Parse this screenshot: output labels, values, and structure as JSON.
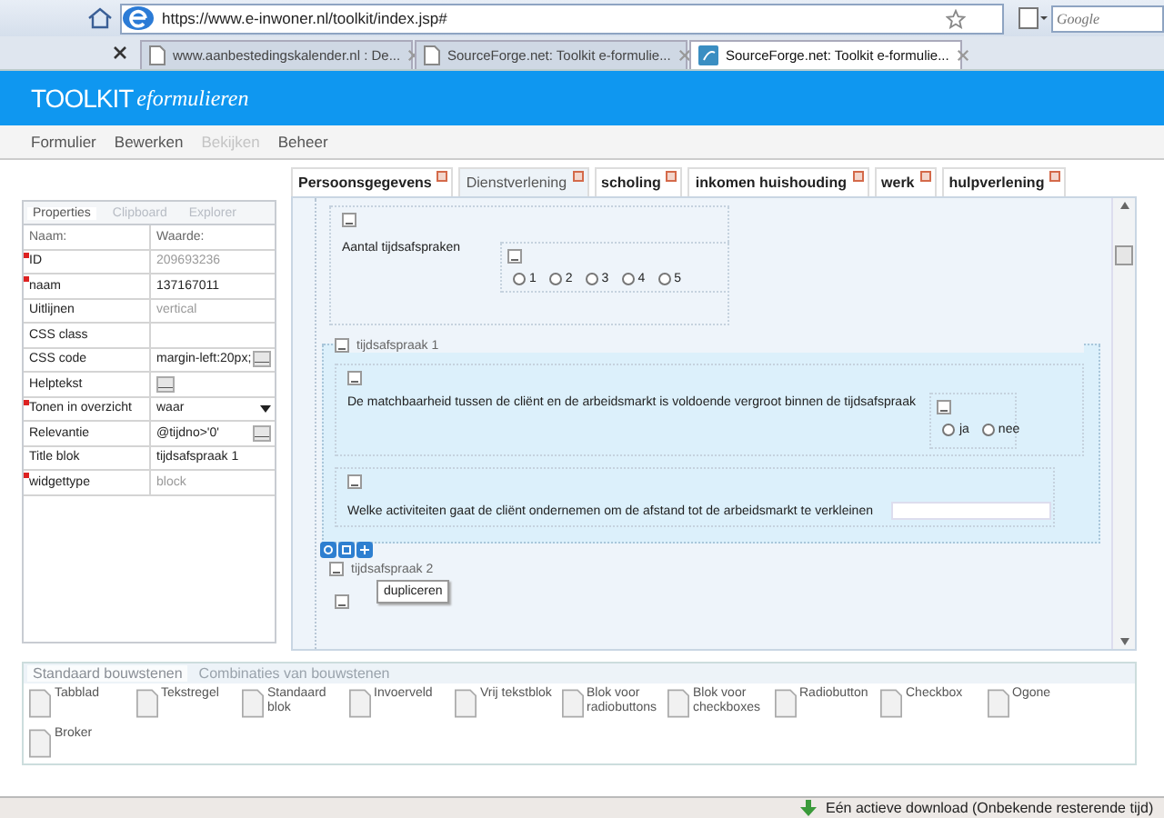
{
  "browser": {
    "address": "https://www.e-inwoner.nl/toolkit/index.jsp#",
    "search_placeholder": "Google",
    "tabs": [
      {
        "title": "www.aanbestedingskalender.nl : De...",
        "kind": "page",
        "selected": false
      },
      {
        "title": "SourceForge.net: Toolkit e-formulie...",
        "kind": "page",
        "selected": false
      },
      {
        "title": "SourceForge.net: Toolkit e-formulie...",
        "kind": "site",
        "selected": true
      }
    ]
  },
  "header": {
    "brand": "TOOLKIT",
    "subtitle": "eformulieren"
  },
  "menu": [
    {
      "label": "Formulier",
      "disabled": false
    },
    {
      "label": "Bewerken",
      "disabled": false
    },
    {
      "label": "Bekijken",
      "disabled": true
    },
    {
      "label": "Beheer",
      "disabled": false
    }
  ],
  "properties": {
    "tabs": [
      {
        "label": "Properties",
        "selected": true
      },
      {
        "label": "Clipboard",
        "selected": false
      },
      {
        "label": "Explorer",
        "selected": false
      }
    ],
    "columns": [
      "Naam:",
      "Waarde:"
    ],
    "rows": [
      {
        "name": "ID",
        "value": "209693236",
        "kind": "readonly",
        "required": true
      },
      {
        "name": "naam",
        "value": "137167011",
        "kind": "text",
        "required": true
      },
      {
        "name": "Uitlijnen",
        "value": "vertical",
        "kind": "readonly",
        "required": false
      },
      {
        "name": "CSS class",
        "kind": "text",
        "required": false
      },
      {
        "name": "CSS code",
        "value": "margin-left:20px;",
        "kind": "button",
        "required": false
      },
      {
        "name": "Helptekst",
        "kind": "button",
        "required": false
      },
      {
        "name": "Tonen in overzicht",
        "value": "waar",
        "kind": "select",
        "required": true
      },
      {
        "name": "Relevantie",
        "value": "@tijdno>'0'",
        "kind": "button",
        "required": false
      },
      {
        "name": "Title blok",
        "value": "tijdsafspraak 1",
        "kind": "text",
        "required": false
      },
      {
        "name": "widgettype",
        "value": "block",
        "kind": "readonly",
        "required": true
      }
    ]
  },
  "form_tabs": [
    {
      "label": "Persoonsgegevens",
      "selected": false
    },
    {
      "label": "Dienstverlening",
      "selected": true
    },
    {
      "label": "scholing",
      "selected": false
    },
    {
      "label": "inkomen huishouding",
      "selected": false
    },
    {
      "label": "werk",
      "selected": false
    },
    {
      "label": "hulpverlening",
      "selected": false
    }
  ],
  "canvas": {
    "question": {
      "label": "Aantal tijdsafspraken",
      "options": [
        {
          "label": "1",
          "selected": false
        },
        {
          "label": "2",
          "selected": false
        },
        {
          "label": "3",
          "selected": false
        },
        {
          "label": "4",
          "selected": false
        },
        {
          "label": "5",
          "selected": false
        }
      ]
    },
    "block": {
      "title": "tijdsafspraak 1",
      "question": {
        "label": "De matchbaarheid tussen de cliënt en de arbeidsmarkt is voldoende vergroot binnen de tijdsafspraak",
        "options": [
          {
            "label": "ja",
            "selected": false
          },
          {
            "label": "nee",
            "selected": false
          }
        ]
      },
      "text_question": {
        "label": "Welke activiteiten gaat de cliënt ondernemen om de afstand tot de arbeidsmarkt te verkleinen"
      }
    },
    "tooltip": "dupliceren",
    "next_block": {
      "title": "tijdsafspraak 2"
    }
  },
  "palette": {
    "tabs": [
      {
        "label": "Standaard bouwstenen",
        "selected": true
      },
      {
        "label": "Combinaties van bouwstenen",
        "selected": false
      }
    ],
    "items": [
      "Tabblad",
      "Tekstregel",
      "Standaard blok",
      "Invoerveld",
      "Vrij tekstblok",
      "Blok voor radiobuttons",
      "Blok voor checkboxes",
      "Radiobutton",
      "Checkbox",
      "Ogone",
      "Broker"
    ]
  },
  "status_bar": {
    "download": "Eén actieve download (Onbekende resterende tijd)"
  }
}
